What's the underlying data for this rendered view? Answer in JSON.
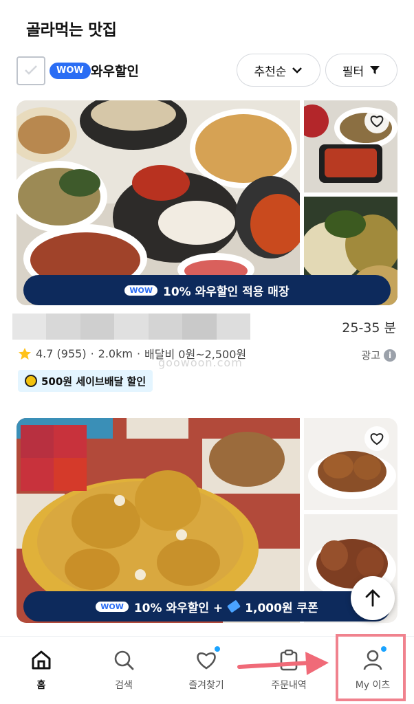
{
  "header": {
    "title": "골라먹는 맛집"
  },
  "filter": {
    "wow_badge": "WOW",
    "wow_label": "와우할인",
    "sort_label": "추천순",
    "filter_label": "필터"
  },
  "cards": [
    {
      "promo_badge": "WOW",
      "promo_text": "10% 와우할인 적용 매장",
      "eta": "25-35 분",
      "rating": "4.7 (955)",
      "distance": "2.0km",
      "delivery_fee": "배달비 0원~2,500원",
      "ad_label": "광고",
      "save_badge": "500원 세이브배달 할인"
    },
    {
      "promo_badge": "WOW",
      "promo_text": "10% 와우할인 +",
      "coupon_text": "1,000원 쿠폰"
    }
  ],
  "watermark": "goowoon.com",
  "bottom_nav": [
    {
      "label": "홈",
      "icon": "home-icon"
    },
    {
      "label": "검색",
      "icon": "search-icon"
    },
    {
      "label": "즐겨찾기",
      "icon": "heart-icon"
    },
    {
      "label": "주문내역",
      "icon": "clipboard-icon"
    },
    {
      "label": "My 이츠",
      "icon": "user-icon"
    }
  ],
  "colors": {
    "accent": "#2a6df4",
    "promo_bar": "#0d2a5c",
    "highlight": "#f0828e"
  }
}
